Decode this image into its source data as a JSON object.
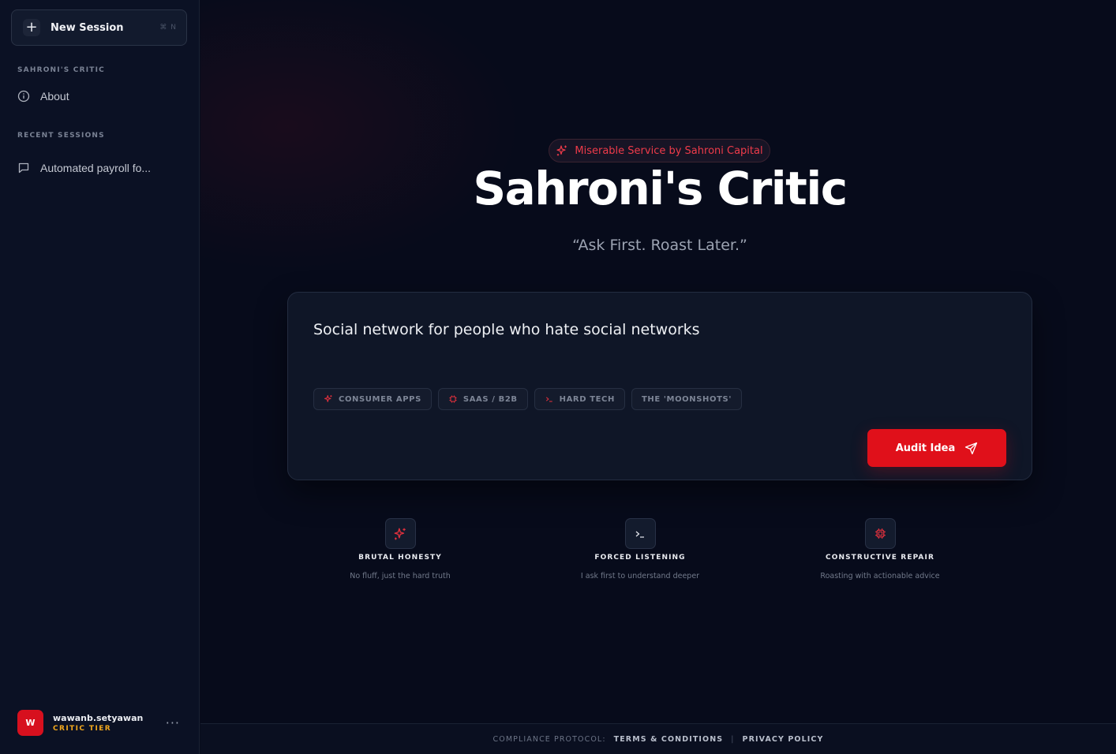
{
  "sidebar": {
    "new_session_label": "New Session",
    "new_session_shortcut": "⌘ N",
    "section_app": "SAHRONI'S CRITIC",
    "about_label": "About",
    "section_recent": "RECENT SESSIONS",
    "recent_sessions": [
      {
        "label": "Automated payroll fo..."
      }
    ],
    "user": {
      "initial": "W",
      "name": "wawanb.setyawan",
      "tier": "CRITIC TIER",
      "more": "···"
    }
  },
  "hero": {
    "badge": "Miserable Service by Sahroni Capital",
    "title": "Sahroni's Critic",
    "tagline": "“Ask First. Roast Later.”"
  },
  "input_card": {
    "idea_text": "Social network for people who hate social networks",
    "chips": [
      {
        "label": "CONSUMER APPS",
        "icon": "sparkles-icon"
      },
      {
        "label": "SAAS / B2B",
        "icon": "chip-icon"
      },
      {
        "label": "HARD TECH",
        "icon": "terminal-icon"
      },
      {
        "label": "THE 'MOONSHOTS'",
        "icon": ""
      }
    ],
    "submit_label": "Audit Idea"
  },
  "features": [
    {
      "title": "BRUTAL HONESTY",
      "desc": "No fluff, just the hard truth",
      "icon": "sparkles-icon"
    },
    {
      "title": "FORCED LISTENING",
      "desc": "I ask first to understand deeper",
      "icon": "terminal-icon"
    },
    {
      "title": "CONSTRUCTIVE REPAIR",
      "desc": "Roasting with actionable advice",
      "icon": "chip-icon"
    }
  ],
  "footer": {
    "label": "COMPLIANCE PROTOCOL:",
    "terms": "TERMS & CONDITIONS",
    "separator": "|",
    "privacy": "PRIVACY POLICY"
  },
  "colors": {
    "accent": "#e0101a",
    "tier": "#f2a81d",
    "background": "#070b1b",
    "sidebar": "#0b1124"
  }
}
